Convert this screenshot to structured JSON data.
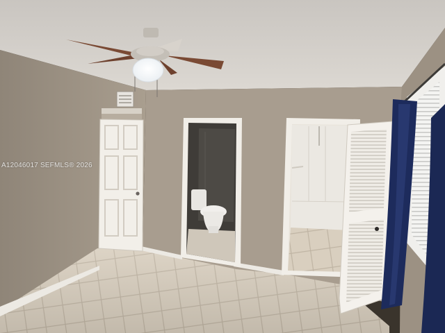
{
  "photo": {
    "watermark": "A12046017 SEFMLS® 2026",
    "subject_icons": {
      "ceiling_fan": "ceiling-fan-icon",
      "light": "light-bulb-icon",
      "door": "door-icon",
      "toilet": "toilet-icon",
      "window": "window-icon",
      "curtain": "curtain-icon",
      "vent": "air-vent-icon"
    }
  },
  "colors": {
    "ceiling": "#d8d4cf",
    "wall": "#a89d8f",
    "wall_shadow": "#8c8275",
    "floor_tile": "#d9cfbf",
    "grout": "#bfb4a3",
    "door_white": "#f2efe9",
    "baseboard": "#ece9e3",
    "curtain_navy": "#1d2b5c",
    "fan_blade": "#7a4a34",
    "bathroom_dark": "#3f3c38"
  }
}
